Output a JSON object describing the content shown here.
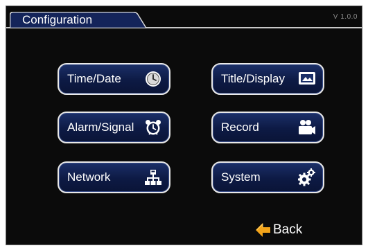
{
  "header": {
    "title": "Configuration",
    "version": "V 1.0.0"
  },
  "menu": {
    "time_date": {
      "label": "Time/Date",
      "icon": "clock-icon"
    },
    "title_display": {
      "label": "Title/Display",
      "icon": "monitor-icon"
    },
    "alarm_signal": {
      "label": "Alarm/Signal",
      "icon": "alarm-clock-icon"
    },
    "record": {
      "label": "Record",
      "icon": "camera-icon"
    },
    "network": {
      "label": "Network",
      "icon": "network-icon"
    },
    "system": {
      "label": "System",
      "icon": "gears-icon"
    }
  },
  "footer": {
    "back_label": "Back",
    "back_icon": "arrow-left-icon"
  },
  "colors": {
    "background": "#0b0b0b",
    "button_fill": "#0d1a44",
    "button_border": "#e9e9e9",
    "tab_fill": "#14245a",
    "back_arrow": "#f3a41a"
  }
}
